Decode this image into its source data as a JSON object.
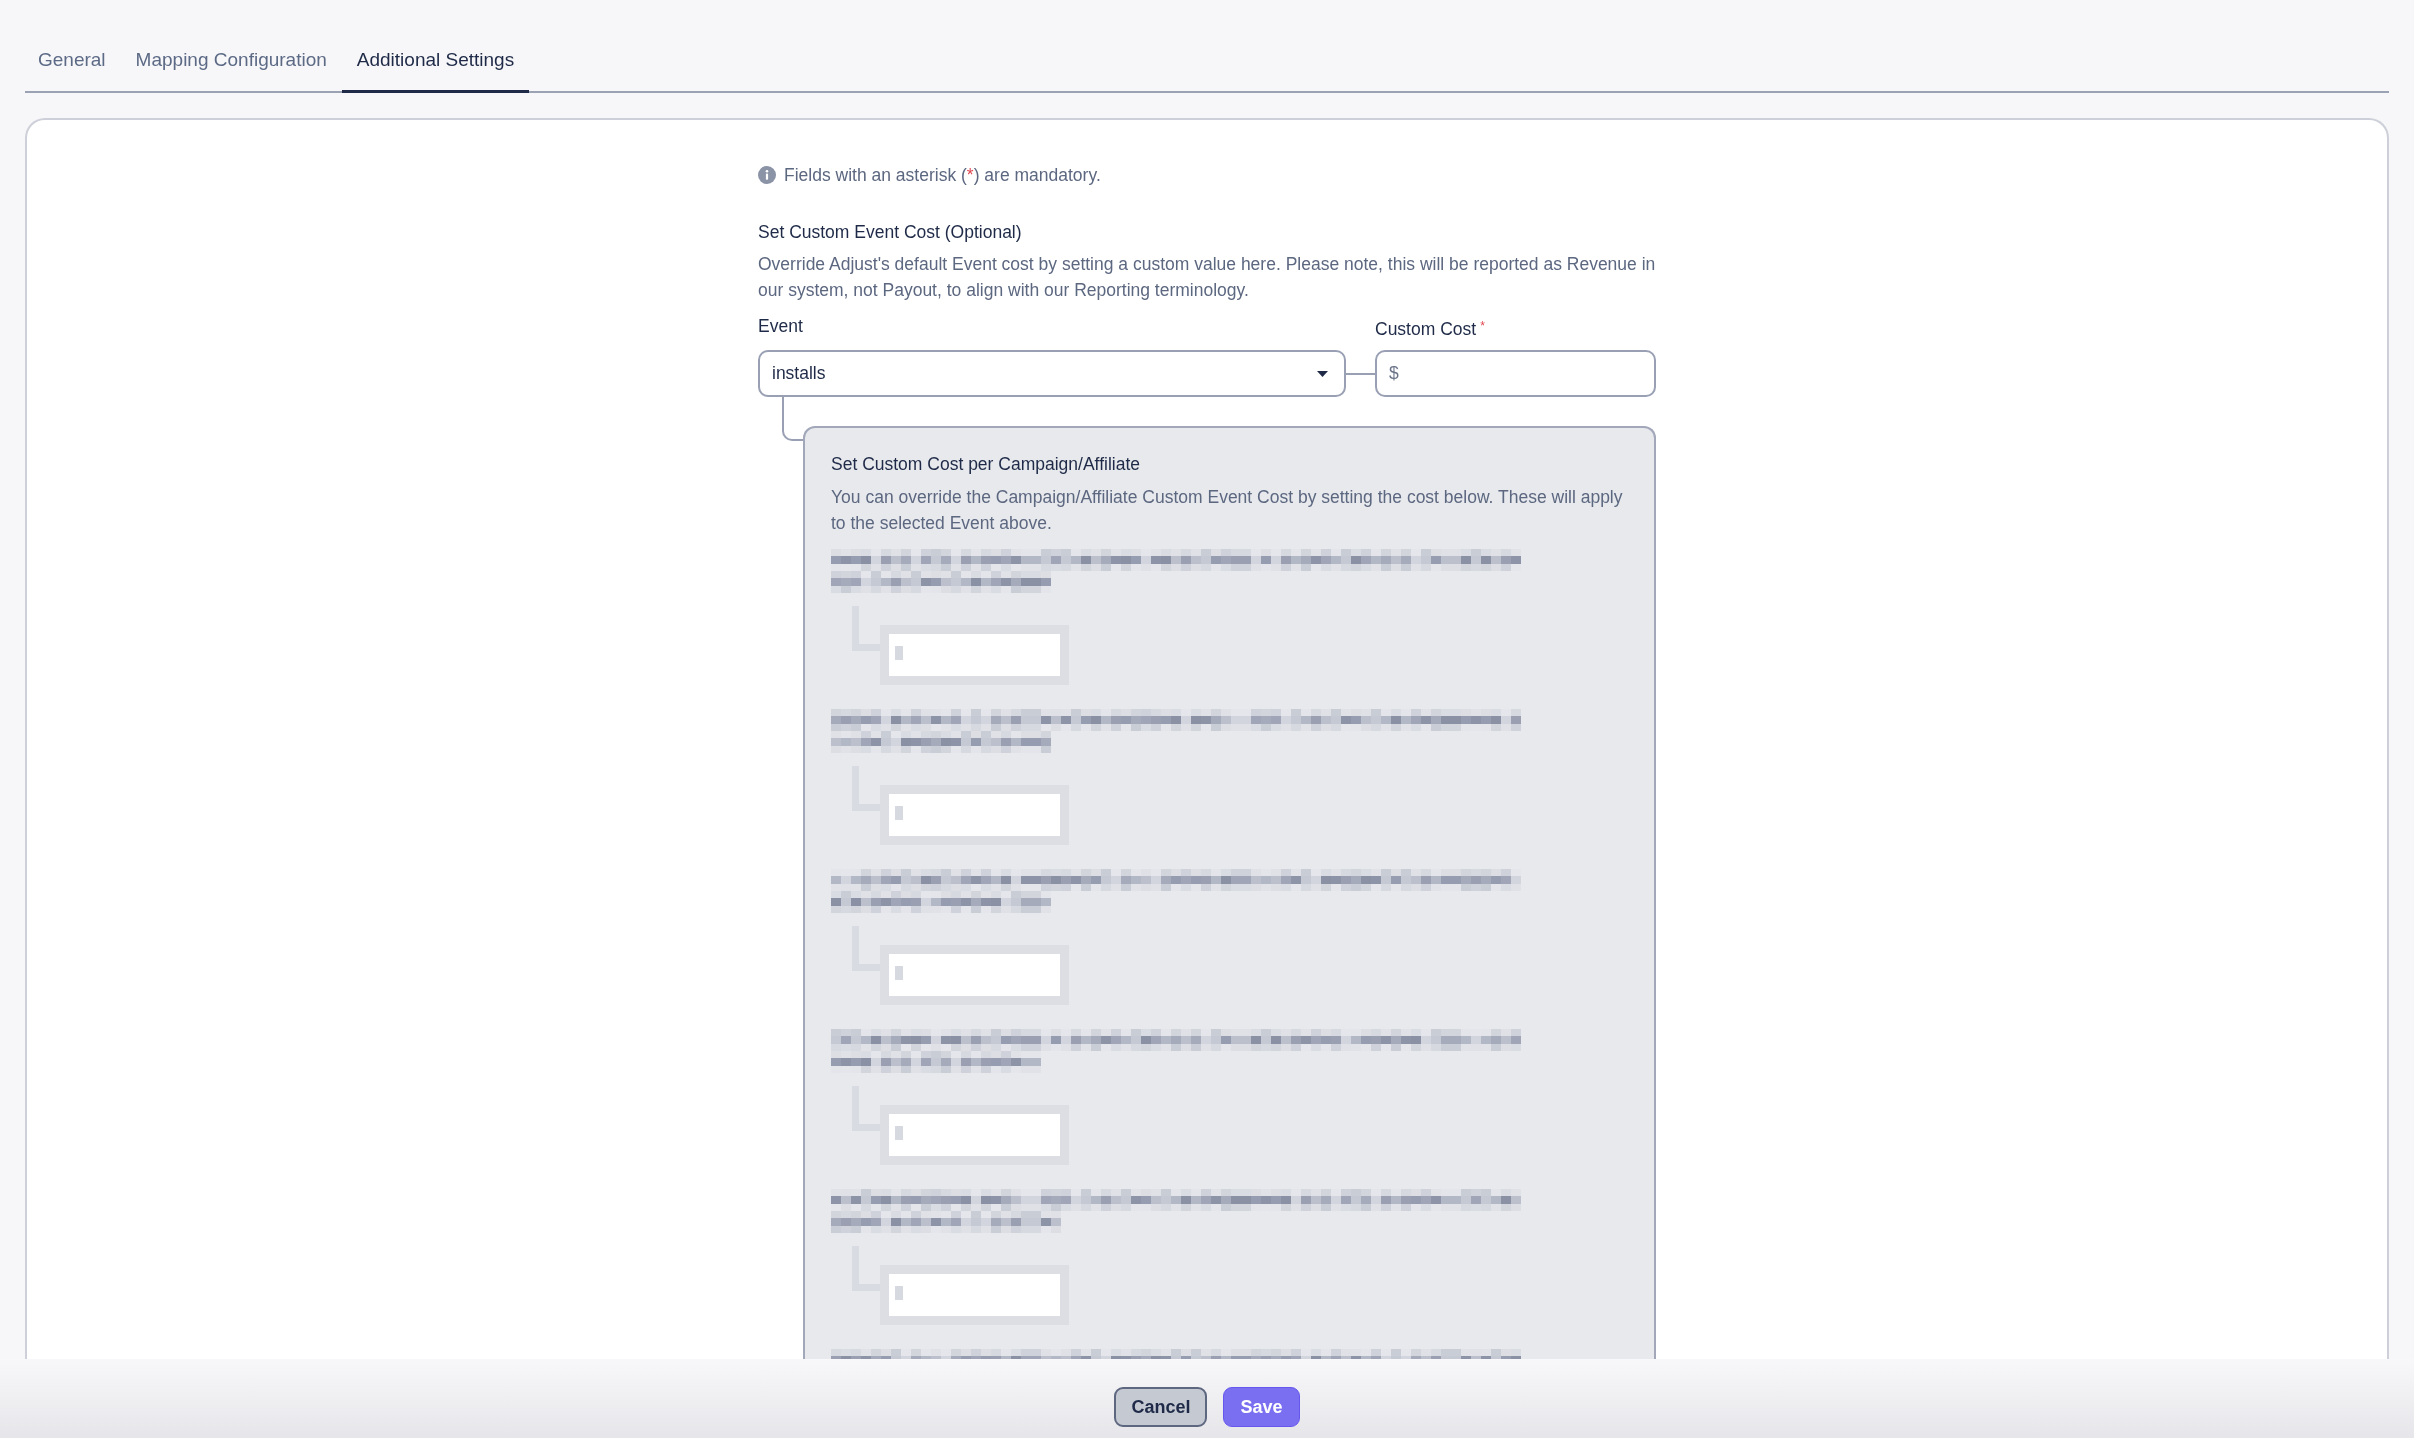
{
  "tabs": [
    {
      "label": "General",
      "selected": false
    },
    {
      "label": "Mapping Configuration",
      "selected": false
    },
    {
      "label": "Additional Settings",
      "selected": true
    }
  ],
  "notice": {
    "text_before": "Fields with an asterisk (",
    "mark": "*",
    "text_after": ") are mandatory."
  },
  "event_cost": {
    "title": "Set Custom Event Cost (Optional)",
    "description": "Override Adjust's default Event cost by setting a custom value here. Please note, this will be reported as Revenue in our system, not Payout, to align with our Reporting terminology.",
    "event_field": {
      "label": "Event",
      "value": "installs"
    },
    "cost_field": {
      "label": "Custom Cost",
      "required_mark": "*",
      "placeholder": "$"
    }
  },
  "campaign_panel": {
    "title": "Set Custom Cost per Campaign/Affiliate",
    "description": "You can override the Campaign/Affiliate Custom Event Cost by setting the cost below. These will apply to the selected Event above.",
    "rows": [
      {
        "kind": "redacted"
      },
      {
        "kind": "redacted"
      },
      {
        "kind": "redacted"
      },
      {
        "kind": "redacted"
      },
      {
        "kind": "redacted"
      },
      {
        "kind": "redacted_partial"
      }
    ]
  },
  "buttons": [
    {
      "label": "Cancel",
      "kind": "secondary"
    },
    {
      "label": "Save",
      "kind": "primary"
    }
  ]
}
